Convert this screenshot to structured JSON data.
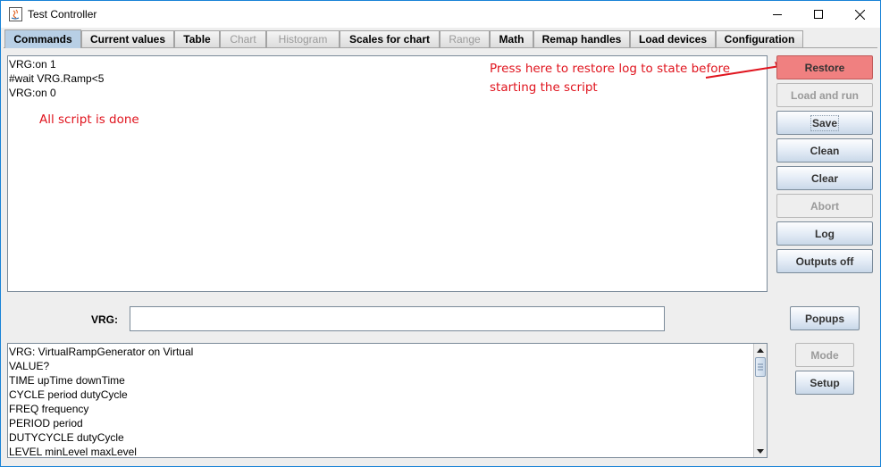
{
  "window": {
    "title": "Test Controller",
    "controls": [
      "minimize-icon",
      "maximize-icon",
      "close-icon"
    ]
  },
  "tabs": [
    {
      "label": "Commands",
      "active": true,
      "enabled": true
    },
    {
      "label": "Current values",
      "active": false,
      "enabled": true
    },
    {
      "label": "Table",
      "active": false,
      "enabled": true
    },
    {
      "label": "Chart",
      "active": false,
      "enabled": false
    },
    {
      "label": "Histogram",
      "active": false,
      "enabled": false
    },
    {
      "label": "Scales for chart",
      "active": false,
      "enabled": true
    },
    {
      "label": "Range",
      "active": false,
      "enabled": false
    },
    {
      "label": "Math",
      "active": false,
      "enabled": true
    },
    {
      "label": "Remap handles",
      "active": false,
      "enabled": true
    },
    {
      "label": "Load devices",
      "active": false,
      "enabled": true
    },
    {
      "label": "Configuration",
      "active": false,
      "enabled": true
    }
  ],
  "script_panel": {
    "lines": [
      "VRG:on 1",
      "#wait VRG.Ramp<5",
      "VRG:on 0"
    ]
  },
  "annotations": {
    "status_note": "All script is done",
    "restore_note_line1": "Press here to restore log to state before",
    "restore_note_line2": "starting the script",
    "note_color": "#e0141e"
  },
  "buttons": {
    "restore": {
      "label": "Restore",
      "enabled": true,
      "color": "#f08080"
    },
    "load_and_run": {
      "label": "Load and run",
      "enabled": false
    },
    "save": {
      "label": "Save",
      "enabled": true
    },
    "clean": {
      "label": "Clean",
      "enabled": true
    },
    "clear": {
      "label": "Clear",
      "enabled": true
    },
    "abort": {
      "label": "Abort",
      "enabled": false
    },
    "log": {
      "label": "Log",
      "enabled": true
    },
    "outputs_off": {
      "label": "Outputs off",
      "enabled": true
    },
    "popups": {
      "label": "Popups",
      "enabled": true
    },
    "mode": {
      "label": "Mode",
      "enabled": false
    },
    "setup": {
      "label": "Setup",
      "enabled": true
    }
  },
  "command_input": {
    "label": "VRG:",
    "value": ""
  },
  "help_panel": {
    "lines": [
      "VRG: VirtualRampGenerator on Virtual",
      "VALUE?",
      "TIME upTime downTime",
      "CYCLE period dutyCycle",
      "FREQ frequency",
      "PERIOD period",
      "DUTYCYCLE dutyCycle",
      "LEVEL minLevel maxLevel"
    ]
  }
}
